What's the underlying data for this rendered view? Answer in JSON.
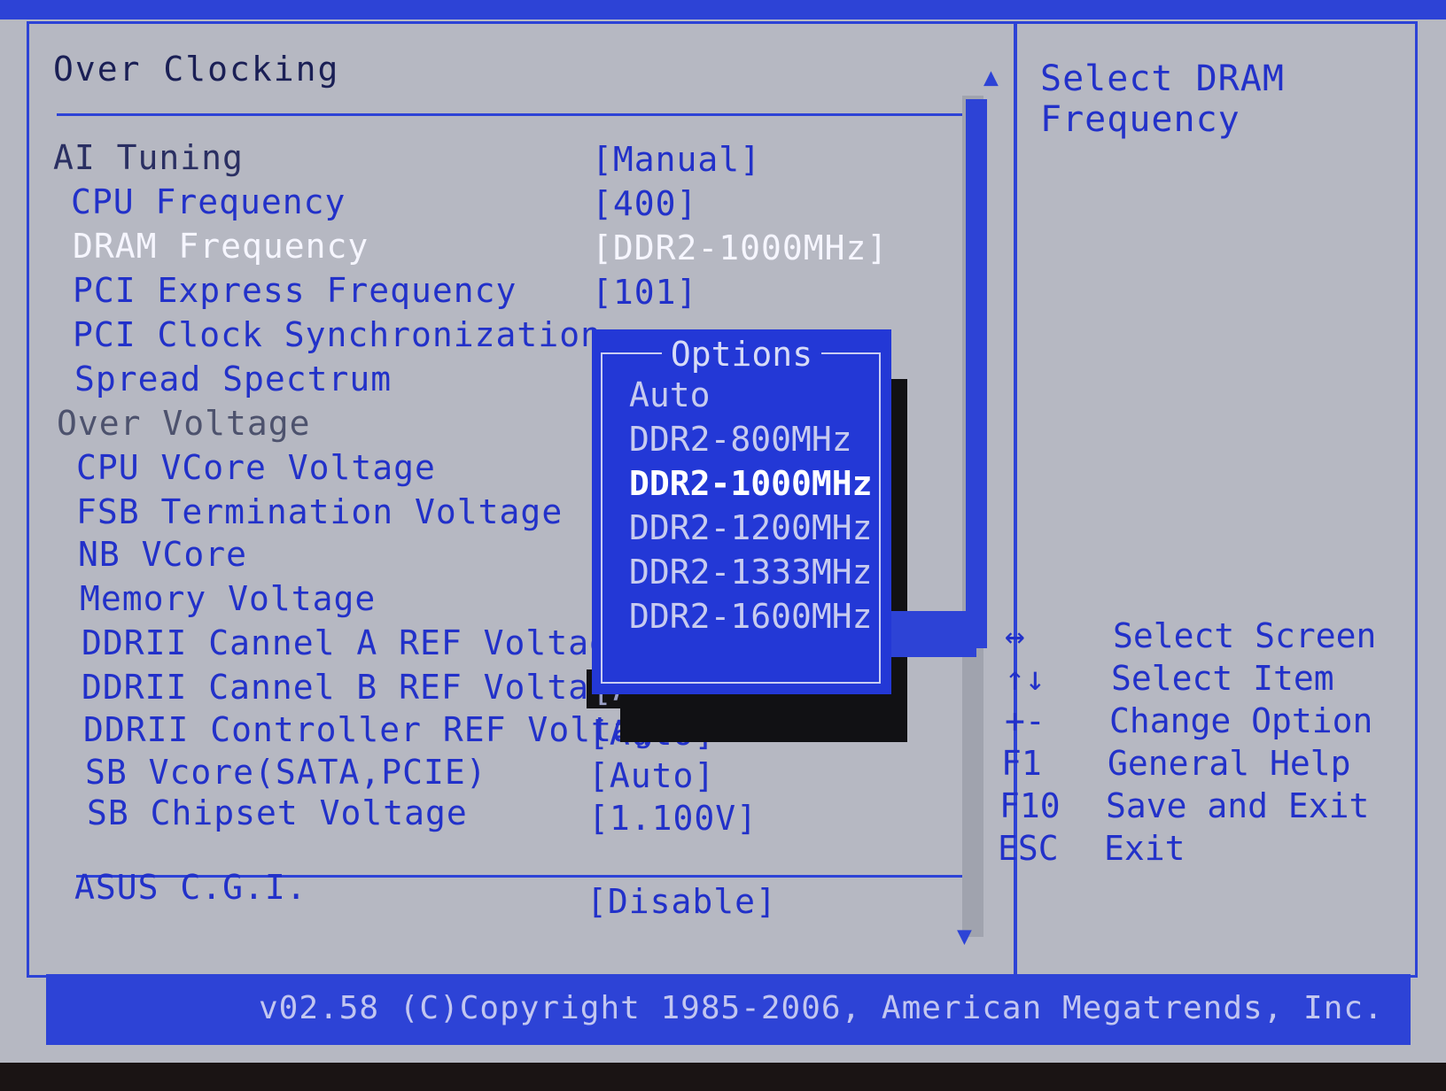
{
  "window": {
    "title": "Over Clocking"
  },
  "settings": [
    {
      "label": "AI Tuning",
      "value": "[Manual]"
    },
    {
      "label": "CPU Frequency",
      "value": "[400]"
    },
    {
      "label": "DRAM Frequency",
      "value": "[DDR2-1000MHz]"
    },
    {
      "label": "PCI Express Frequency",
      "value": "[101]"
    },
    {
      "label": "PCI Clock Synchronization",
      "value": ""
    },
    {
      "label": "Spread Spectrum",
      "value": ""
    },
    {
      "label": "Over Voltage",
      "value": ""
    },
    {
      "label": "CPU VCore Voltage",
      "value": ""
    },
    {
      "label": "FSB Termination Voltage",
      "value": ""
    },
    {
      "label": "NB VCore",
      "value": ""
    },
    {
      "label": "Memory Voltage",
      "value": ""
    },
    {
      "label": "DDRII Cannel A REF Voltage",
      "value": ""
    },
    {
      "label": "DDRII Cannel B REF Voltage",
      "value": "[Auto]"
    },
    {
      "label": "DDRII Controller REF Voltage",
      "value": "[Auto]"
    },
    {
      "label": "SB Vcore(SATA,PCIE)",
      "value": "[Auto]"
    },
    {
      "label": "SB Chipset Voltage",
      "value": "[1.100V]"
    },
    {
      "label": "ASUS C.G.I.",
      "value": "[Disable]"
    }
  ],
  "popup": {
    "title": "Options",
    "options": [
      "Auto",
      "DDR2-800MHz",
      "DDR2-1000MHz",
      "DDR2-1200MHz",
      "DDR2-1333MHz",
      "DDR2-1600MHz"
    ],
    "selected": "DDR2-1000MHz"
  },
  "help": {
    "title": "Select DRAM Frequency",
    "keys": [
      {
        "key": "↔",
        "desc": "Select Screen"
      },
      {
        "key": "↑↓",
        "desc": "Select Item"
      },
      {
        "key": "+-",
        "desc": "Change Option"
      },
      {
        "key": "F1",
        "desc": "General Help"
      },
      {
        "key": "F10",
        "desc": "Save and Exit"
      },
      {
        "key": "ESC",
        "desc": "Exit"
      }
    ]
  },
  "footer": {
    "text": "v02.58 (C)Copyright 1985-2006, American Megatrends, Inc."
  },
  "colors": {
    "accent": "#2d43d6",
    "background": "#b6b8c2",
    "text": "#2231c9"
  },
  "icons": {
    "scroll_up": "triangle-up",
    "scroll_down": "triangle-down"
  }
}
